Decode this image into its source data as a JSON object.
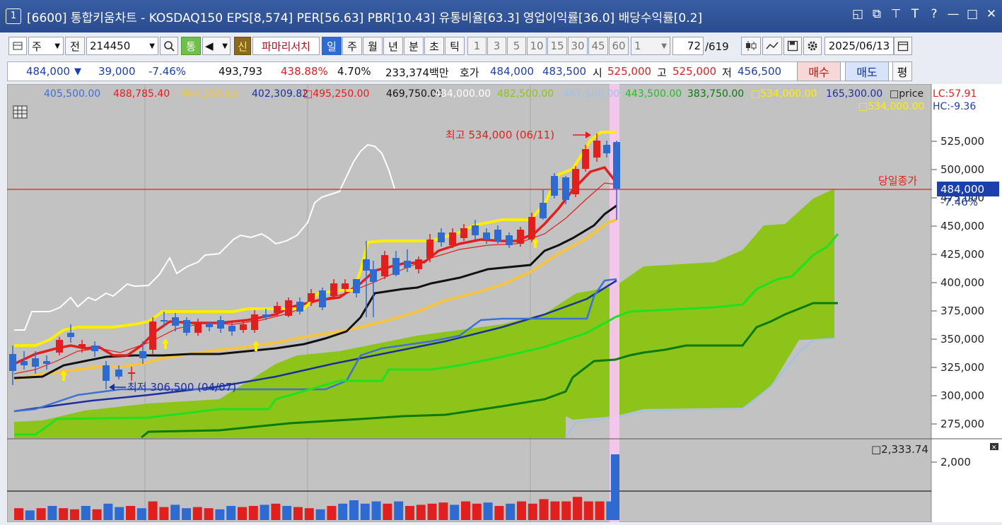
{
  "window": {
    "number": "1",
    "title": "[6600] 통합키움차트 - KOSDAQ150 EPS[8,574] PER[56.63] PBR[10.43] 유통비율[63.3] 영업이익률[36.0] 배당수익률[0.2]",
    "controls": [
      "◱",
      "⧉",
      "⊤",
      "T",
      "?",
      "—",
      "□",
      "✕"
    ]
  },
  "toolbar": {
    "market": "주",
    "all": "전",
    "code": "214450",
    "tong": "통",
    "new_badge": "신",
    "stock_name": "파마리서치",
    "periods": [
      "일",
      "주",
      "월",
      "년",
      "분",
      "초",
      "틱"
    ],
    "active_period": "일",
    "minutes": [
      "1",
      "3",
      "5",
      "10",
      "15",
      "30",
      "45",
      "60"
    ],
    "count_value": "1",
    "bars_shown": "72",
    "bars_total": "/619",
    "date": "2025/06/13"
  },
  "quote": {
    "price": "484,000",
    "down_mark": "▼",
    "change": "39,000",
    "change_pct": "-7.46%",
    "volume": "493,793",
    "vol_ratio": "438.88%",
    "turnover": "4.70%",
    "amount": "233,374백만",
    "hoga_label": "호가",
    "ask": "484,000",
    "bid": "483,500",
    "open_label": "시",
    "open": "525,000",
    "high_label": "고",
    "high": "525,000",
    "low_label": "저",
    "low": "456,500",
    "buy_button": "매수",
    "sell_button": "매도",
    "eval_button": "평"
  },
  "legend": {
    "values": [
      {
        "text": "405,500.00",
        "color": "#3f6fd8"
      },
      {
        "text": "488,785.40",
        "color": "#e0201e"
      },
      {
        "text": "464,358.63",
        "color": "#f5c542"
      },
      {
        "text": "402,309.82",
        "color": "#1c2f9c"
      },
      {
        "text": "□495,250.00",
        "color": "#e0201e"
      },
      {
        "text": "469,750.00",
        "color": "#111111"
      },
      {
        "text": "484,000.00",
        "color": "#ffffff"
      },
      {
        "text": "482,500.00",
        "color": "#8cc41a"
      },
      {
        "text": "467,500.00",
        "color": "#9ec3e8"
      },
      {
        "text": "443,500.00",
        "color": "#20c020"
      },
      {
        "text": "383,750.00",
        "color": "#0a7a0a"
      },
      {
        "text": "□534,000.00",
        "color": "#ffee00"
      },
      {
        "text": "165,300.00",
        "color": "#1c2f9c"
      },
      {
        "text": "□price",
        "color": "#222222"
      }
    ],
    "second_line": "□534,000.00",
    "lc": "LC:57.91",
    "hc": "HC:-9.36"
  },
  "annotations": {
    "high_label": "최고 534,000 (06/11)",
    "low_label": "최저 306,500 (04/07)",
    "prev_close_label": "당일종가",
    "current_price": "484,000",
    "current_pct": "-7.46%",
    "volume_value": "□2,333.74"
  },
  "price_axis": {
    "ticks": [
      "525,000",
      "500,000",
      "475,000",
      "450,000",
      "425,000",
      "400,000",
      "375,000",
      "350,000",
      "325,000",
      "300,000",
      "275,000"
    ],
    "volume_tick": "2,000"
  },
  "colors": {
    "chart_bg": "#c2c2c2",
    "up": "#e0201e",
    "down": "#2f6ad0",
    "cloud": "#8cc41a",
    "highlight": "#f6c6ee"
  }
}
